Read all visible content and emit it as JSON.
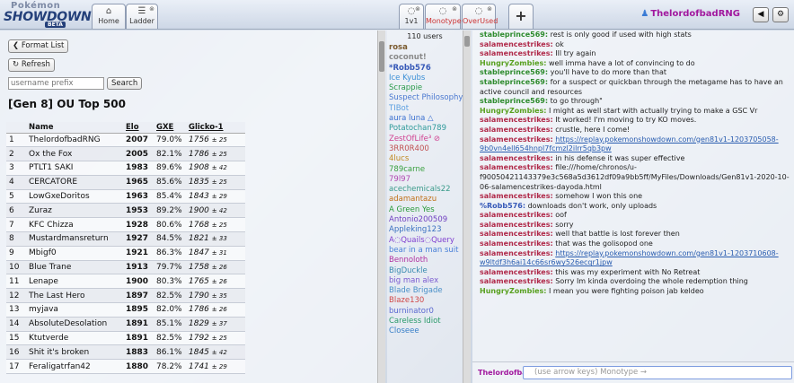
{
  "header": {
    "logo": {
      "line1": "Pokémon",
      "line2": "SHOWDOWN!",
      "badge": "BETA"
    },
    "tabs": [
      {
        "label": "Home",
        "icon": "home-icon"
      },
      {
        "label": "Ladder",
        "icon": "list-icon"
      }
    ],
    "room_tabs": [
      {
        "label": "1v1",
        "icon": "chat-bubble-icon"
      },
      {
        "label": "Monotype",
        "icon": "chat-bubble-icon"
      },
      {
        "label": "OverUsed",
        "icon": "chat-bubble-icon"
      }
    ],
    "add_tab": "+",
    "username": "ThelordofbadRNG"
  },
  "ladder": {
    "format_list_label": "Format List",
    "refresh_label": "Refresh",
    "search_placeholder": "username prefix",
    "search_label": "Search",
    "title": "[Gen 8] OU Top 500",
    "columns": [
      "",
      "Name",
      "Elo",
      "GXE",
      "Glicko-1"
    ],
    "rows": [
      {
        "rank": "1",
        "name": "ThelordofbadRNG",
        "elo": "2007",
        "gxe": "79.0%",
        "glicko": "1756",
        "dev": "± 25"
      },
      {
        "rank": "2",
        "name": "Ox the Fox",
        "elo": "2005",
        "gxe": "82.1%",
        "glicko": "1786",
        "dev": "± 25"
      },
      {
        "rank": "3",
        "name": "PTLT1 SAKI",
        "elo": "1983",
        "gxe": "89.6%",
        "glicko": "1908",
        "dev": "± 42"
      },
      {
        "rank": "4",
        "name": "CERCATORE",
        "elo": "1965",
        "gxe": "85.6%",
        "glicko": "1835",
        "dev": "± 25"
      },
      {
        "rank": "5",
        "name": "LowGxeDoritos",
        "elo": "1963",
        "gxe": "85.4%",
        "glicko": "1843",
        "dev": "± 29"
      },
      {
        "rank": "6",
        "name": "Zuraz",
        "elo": "1953",
        "gxe": "89.2%",
        "glicko": "1900",
        "dev": "± 42"
      },
      {
        "rank": "7",
        "name": "KFC Chizza",
        "elo": "1928",
        "gxe": "80.6%",
        "glicko": "1768",
        "dev": "± 25"
      },
      {
        "rank": "8",
        "name": "Mustardmansreturn",
        "elo": "1927",
        "gxe": "84.5%",
        "glicko": "1821",
        "dev": "± 33"
      },
      {
        "rank": "9",
        "name": "Mbigf0",
        "elo": "1921",
        "gxe": "86.3%",
        "glicko": "1847",
        "dev": "± 31"
      },
      {
        "rank": "10",
        "name": "Blue Trane",
        "elo": "1913",
        "gxe": "79.7%",
        "glicko": "1758",
        "dev": "± 26"
      },
      {
        "rank": "11",
        "name": "Lenape",
        "elo": "1900",
        "gxe": "80.3%",
        "glicko": "1765",
        "dev": "± 26"
      },
      {
        "rank": "12",
        "name": "The Last Hero",
        "elo": "1897",
        "gxe": "82.5%",
        "glicko": "1790",
        "dev": "± 35"
      },
      {
        "rank": "13",
        "name": "myjava",
        "elo": "1895",
        "gxe": "82.0%",
        "glicko": "1786",
        "dev": "± 26"
      },
      {
        "rank": "14",
        "name": "AbsoluteDesolation",
        "elo": "1891",
        "gxe": "85.1%",
        "glicko": "1829",
        "dev": "± 37"
      },
      {
        "rank": "15",
        "name": "Ktutverde",
        "elo": "1891",
        "gxe": "82.5%",
        "glicko": "1792",
        "dev": "± 25"
      },
      {
        "rank": "16",
        "name": "Shit it's broken",
        "elo": "1883",
        "gxe": "86.1%",
        "glicko": "1845",
        "dev": "± 42"
      },
      {
        "rank": "17",
        "name": "Feraligatrfan42",
        "elo": "1880",
        "gxe": "78.2%",
        "glicko": "1741",
        "dev": "± 29"
      }
    ]
  },
  "userlist": {
    "count_label": "110 users",
    "users": [
      {
        "prefix": "",
        "name": "rosa",
        "color": "#7a5a2e",
        "bold": true
      },
      {
        "prefix": "",
        "name": "coconut!",
        "color": "#8a8a8a",
        "bold": true
      },
      {
        "prefix": "*",
        "name": "Robb576",
        "color": "#3659b8",
        "bold": true
      },
      {
        "prefix": "",
        "name": "Ice Kyubs",
        "color": "#3b8fd6",
        "bold": false
      },
      {
        "prefix": "",
        "name": "Scrappie",
        "color": "#2a9a4a",
        "bold": false
      },
      {
        "prefix": "",
        "name": "Suspect Philosophy",
        "color": "#4a78d0",
        "bold": false
      },
      {
        "prefix": "",
        "name": "TIBot",
        "color": "#5ea0e0",
        "bold": false
      },
      {
        "prefix": "",
        "name": "aura luna △",
        "color": "#3a6fd0",
        "bold": false
      },
      {
        "prefix": "",
        "name": "Potatochan789",
        "color": "#2e9a9a",
        "bold": false
      },
      {
        "prefix": "",
        "name": "ZestOfLife³ ⊘",
        "color": "#d04090",
        "bold": false
      },
      {
        "prefix": "",
        "name": "3RR0R400",
        "color": "#c05050",
        "bold": false
      },
      {
        "prefix": "",
        "name": "4lucs",
        "color": "#c08a20",
        "bold": false
      },
      {
        "prefix": "",
        "name": "789carne",
        "color": "#3aa040",
        "bold": false
      },
      {
        "prefix": "",
        "name": "79l97",
        "color": "#b048b0",
        "bold": false
      },
      {
        "prefix": "",
        "name": "acechemicals22",
        "color": "#3a9a8a",
        "bold": false
      },
      {
        "prefix": "",
        "name": "adamantazu",
        "color": "#c07018",
        "bold": false
      },
      {
        "prefix": "",
        "name": "A Green Yes",
        "color": "#2a9a3a",
        "bold": false
      },
      {
        "prefix": "",
        "name": "Antonio200509",
        "color": "#7040c0",
        "bold": false
      },
      {
        "prefix": "",
        "name": "Appleking123",
        "color": "#3a70c0",
        "bold": false
      },
      {
        "prefix": "",
        "name": "A◌Quails◌Query",
        "color": "#8040d0",
        "bold": false
      },
      {
        "prefix": "",
        "name": "bear in a man suit",
        "color": "#4a80d8",
        "bold": false
      },
      {
        "prefix": "",
        "name": "Bennoloth",
        "color": "#b030a0",
        "bold": false
      },
      {
        "prefix": "",
        "name": "BigDuckle",
        "color": "#3a8ab0",
        "bold": false
      },
      {
        "prefix": "",
        "name": "big man alex",
        "color": "#7a5ad0",
        "bold": false
      },
      {
        "prefix": "",
        "name": "Blade Brigade",
        "color": "#4a90c8",
        "bold": false
      },
      {
        "prefix": "",
        "name": "Blaze130",
        "color": "#d04848",
        "bold": false
      },
      {
        "prefix": "",
        "name": "burninator0",
        "color": "#5a68d0",
        "bold": false
      },
      {
        "prefix": "",
        "name": "Careless Idiot",
        "color": "#2a9a6a",
        "bold": false
      },
      {
        "prefix": "",
        "name": "Closeee",
        "color": "#3a80c8",
        "bold": false
      }
    ]
  },
  "chat": {
    "messages": [
      {
        "user": "stableprince569:",
        "color": "#2e8b2e",
        "text": "rest is only good if used with high stats"
      },
      {
        "user": "salamencestrikes:",
        "color": "#b02a4a",
        "text": "ok"
      },
      {
        "user": "salamencestrikes:",
        "color": "#b02a4a",
        "text": "Ill try again"
      },
      {
        "user": "HungryZombies:",
        "color": "#58a020",
        "text": "well imma have a lot of convincing to do"
      },
      {
        "user": "stableprince569:",
        "color": "#2e8b2e",
        "text": "you'll have to do more than that"
      },
      {
        "user": "stableprince569:",
        "color": "#2e8b2e",
        "text": "for a suspect or quickban through the metagame has to have an active council and resources"
      },
      {
        "user": "stableprince569:",
        "color": "#2e8b2e",
        "text": "to go through\""
      },
      {
        "user": "HungryZombies:",
        "color": "#58a020",
        "text": "I might as well start with actually trying to make a GSC Vr"
      },
      {
        "user": "salamencestrikes:",
        "color": "#b02a4a",
        "text": "It worked! I'm moving to try KO moves."
      },
      {
        "user": "salamencestrikes:",
        "color": "#b02a4a",
        "text": "crustle, here I come!"
      },
      {
        "user": "salamencestrikes:",
        "color": "#b02a4a",
        "text": "",
        "link": "https://replay.pokemonshowdown.com/gen81v1-1203705058-9b0vn4ell654hnpl7fcmzl2ilrr5qb3pw"
      },
      {
        "user": "salamencestrikes:",
        "color": "#b02a4a",
        "text": "in his defense it was super effective"
      },
      {
        "user": "salamencestrikes:",
        "color": "#b02a4a",
        "text": "file:///home/chronos/u-f90050421143379e3c568a5d3612df09a9bb5ff/MyFiles/Downloads/Gen81v1-2020-10-06-salamencestrikes-dayoda.html"
      },
      {
        "user": "salamencestrikes:",
        "color": "#b02a4a",
        "text": "somehow I won this one"
      },
      {
        "user": "%Robb576:",
        "color": "#3659b8",
        "text": "downloads don't work, only uploads"
      },
      {
        "user": "salamencestrikes:",
        "color": "#b02a4a",
        "text": "oof"
      },
      {
        "user": "salamencestrikes:",
        "color": "#b02a4a",
        "text": "sorry"
      },
      {
        "user": "salamencestrikes:",
        "color": "#b02a4a",
        "text": "well that battle is lost forever then"
      },
      {
        "user": "salamencestrikes:",
        "color": "#b02a4a",
        "text": "that was the golisopod one"
      },
      {
        "user": "salamencestrikes:",
        "color": "#b02a4a",
        "text": "",
        "link": "https://replay.pokemonshowdown.com/gen81v1-1203710608-w9ltdf3h6ai14c66sr6wy526ecqr1jpw"
      },
      {
        "user": "salamencestrikes:",
        "color": "#b02a4a",
        "text": "this was my experiment with No Retreat"
      },
      {
        "user": "salamencestrikes:",
        "color": "#b02a4a",
        "text": "Sorry Im kinda overdoing the whole redemption thing"
      },
      {
        "user": "HungryZombies:",
        "color": "#58a020",
        "text": "I mean you were fighting poison jab keldeo"
      }
    ],
    "input_user": "Thelordofba",
    "input_placeholder": "(use arrow keys) Monotype →"
  }
}
